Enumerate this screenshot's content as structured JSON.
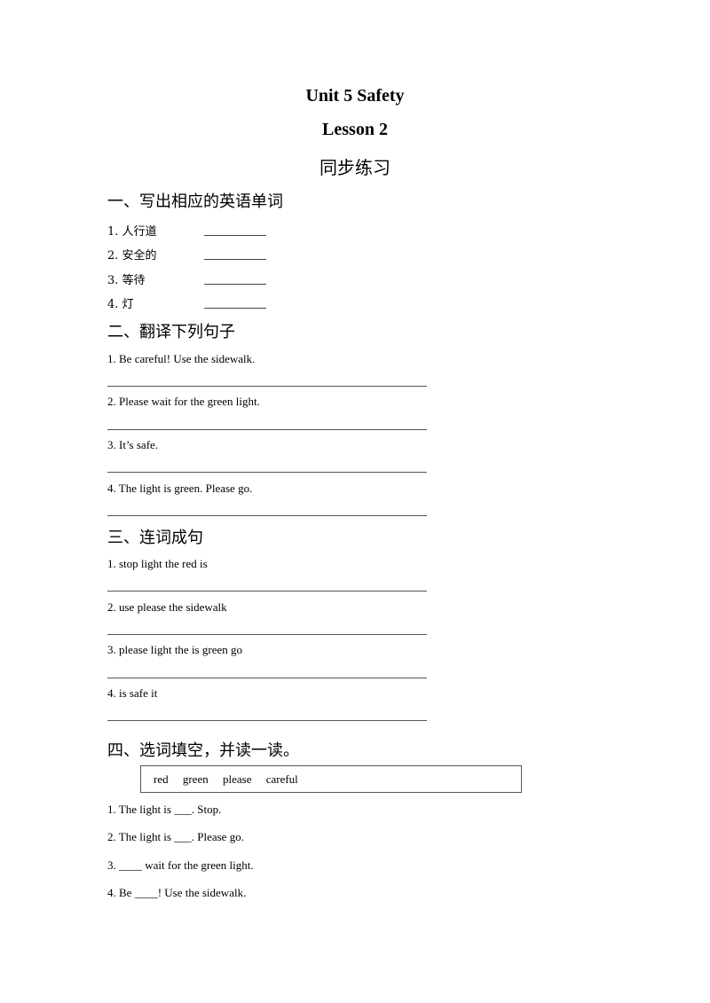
{
  "header": {
    "title": "Unit 5 Safety",
    "lesson": "Lesson 2",
    "subtitle": "同步练习"
  },
  "section1": {
    "heading": "一、写出相应的英语单词",
    "items": [
      {
        "label": "1.  人行道",
        "blank": ""
      },
      {
        "label": "2.  安全的",
        "blank": ""
      },
      {
        "label": "3.  等待",
        "blank": ""
      },
      {
        "label": "4.  灯",
        "blank": ""
      }
    ]
  },
  "section2": {
    "heading": "二、翻译下列句子",
    "items": [
      {
        "text": "1. Be careful! Use the sidewalk.",
        "answer": ""
      },
      {
        "text": "2. Please wait for the green light.",
        "answer": ""
      },
      {
        "text": "3. It’s safe.",
        "answer": ""
      },
      {
        "text": "4. The light is green. Please go.",
        "answer": ""
      }
    ]
  },
  "section3": {
    "heading": "三、连词成句",
    "items": [
      {
        "text": "1. stop light the red is",
        "answer": ""
      },
      {
        "text": "2. use please the sidewalk",
        "answer": ""
      },
      {
        "text": "3. please light the is green go",
        "answer": ""
      },
      {
        "text": "4. is safe it",
        "answer": ""
      }
    ]
  },
  "section4": {
    "heading": "四、选词填空，并读一读。",
    "word_bank": [
      "red",
      "green",
      "please",
      "careful"
    ],
    "items": [
      {
        "text": "1. The light is ___. Stop."
      },
      {
        "text": "2. The light is ___. Please go."
      },
      {
        "text": "3. ____ wait for the green light."
      },
      {
        "text": "4. Be ____! Use the sidewalk."
      }
    ]
  }
}
